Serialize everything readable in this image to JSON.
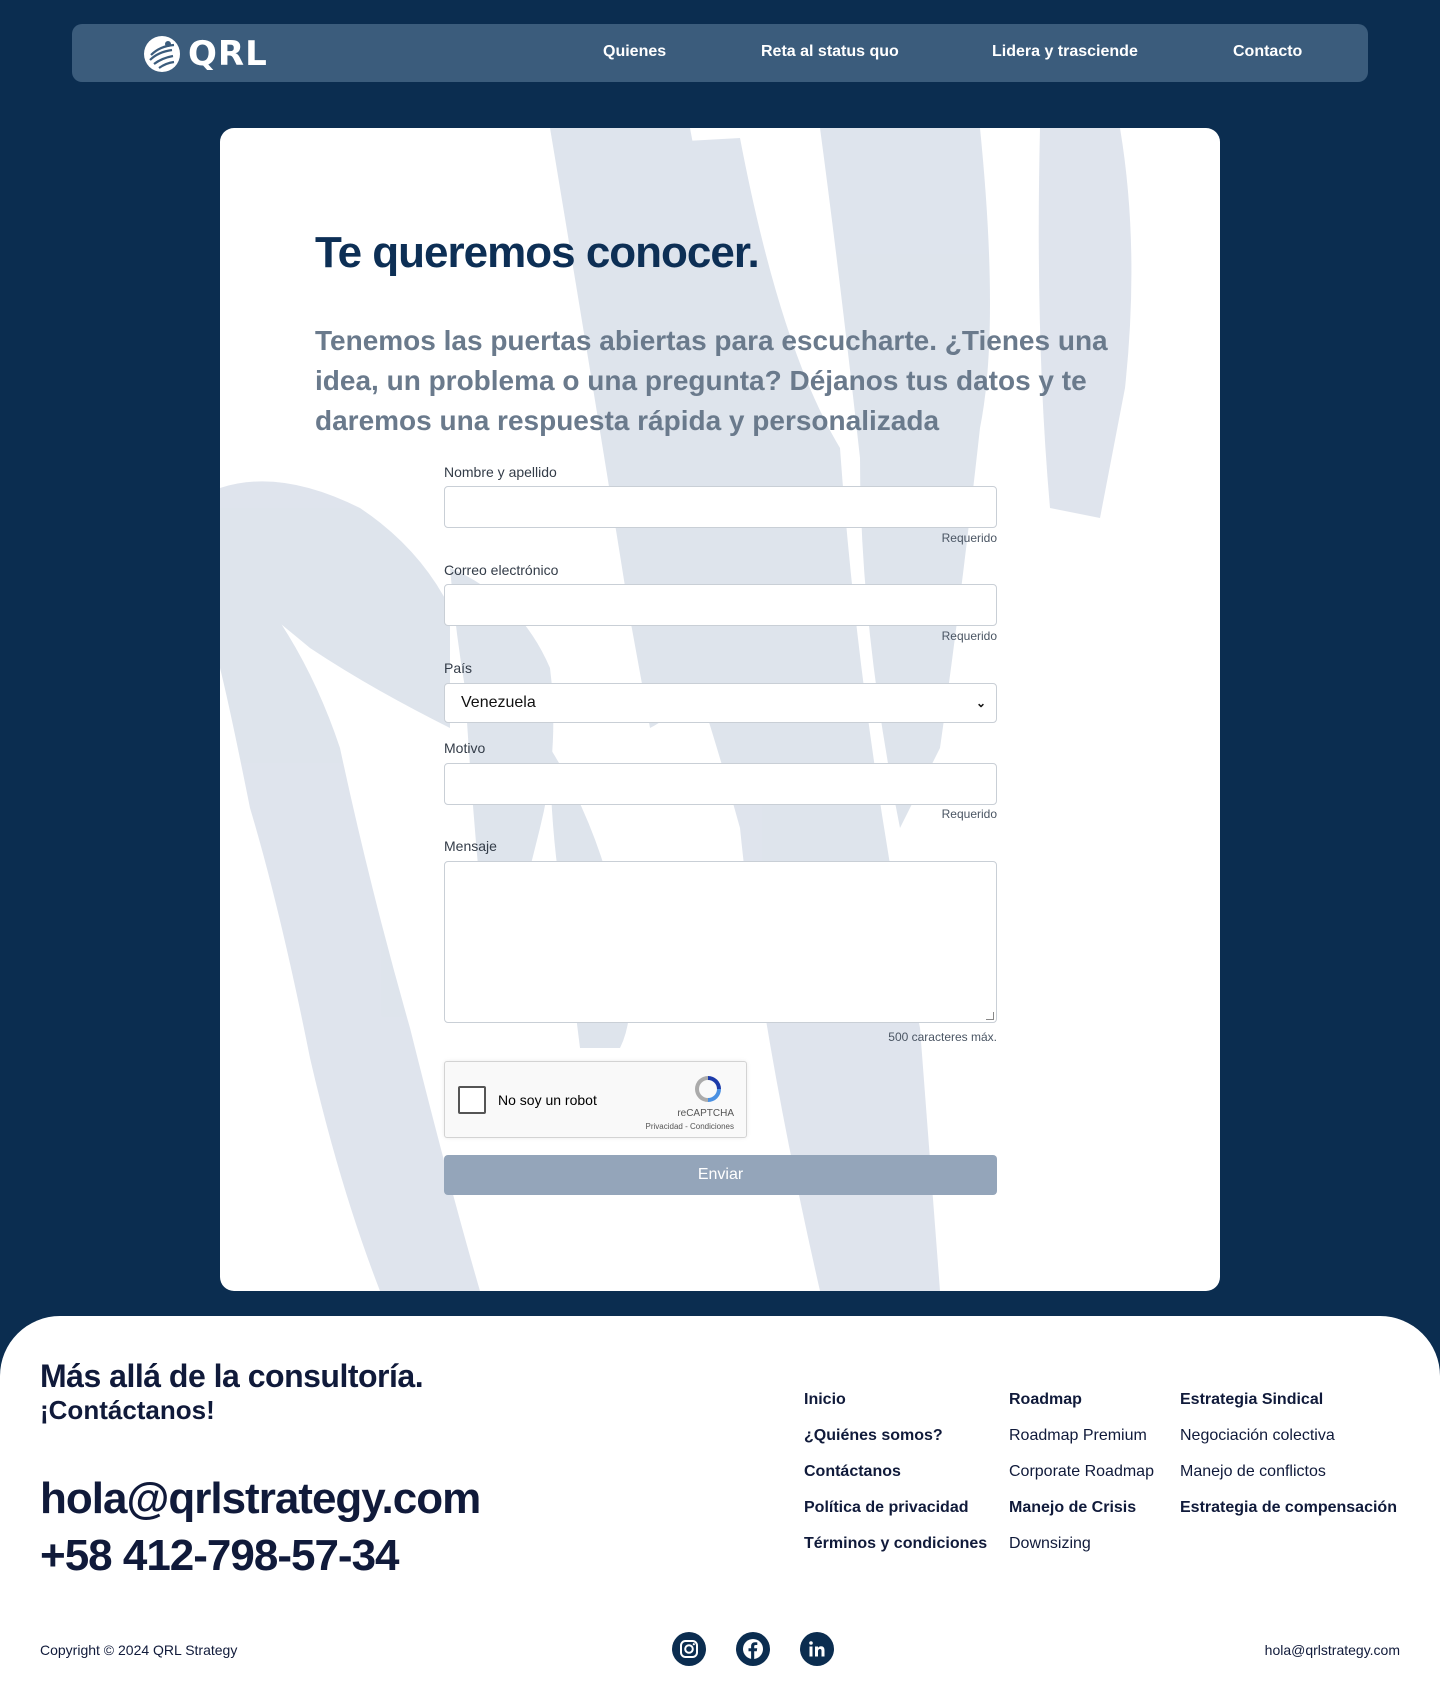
{
  "nav": {
    "logo_text": "QRL",
    "links": [
      "Quienes",
      "Reta al status quo",
      "Lidera y trasciende",
      "Contacto"
    ]
  },
  "form": {
    "title": "Te queremos conocer.",
    "subtitle": "Tenemos las puertas abiertas para escucharte. ¿Tienes una idea, un problema o una pregunta? Déjanos tus datos y te daremos una respuesta rápida y personalizada",
    "name_label": "Nombre y apellido",
    "name_hint": "Requerido",
    "email_label": "Correo electrónico",
    "email_hint": "Requerido",
    "country_label": "País",
    "country_value": "Venezuela",
    "motive_label": "Motivo",
    "motive_hint": "Requerido",
    "message_label": "Mensaje",
    "message_hint": "500 caracteres máx.",
    "captcha_label": "No soy un robot",
    "captcha_brand": "reCAPTCHA",
    "captcha_links": "Privacidad - Condiciones",
    "submit_label": "Enviar"
  },
  "footer": {
    "tagline_1": "Más allá de la consultoría.",
    "tagline_2": "¡Contáctanos!",
    "email": "hola@qrlstrategy.com",
    "phone": "+58 412-798-57-34",
    "col1": [
      "Inicio",
      "¿Quiénes somos?",
      "Contáctanos",
      "Política de privacidad",
      "Términos y condiciones"
    ],
    "col2": [
      "Roadmap",
      "Roadmap Premium",
      "Corporate Roadmap",
      "Manejo de Crisis",
      "Downsizing"
    ],
    "col3": [
      "Estrategia Sindical",
      "Negociación colectiva",
      "Manejo de conflictos",
      "Estrategia de compensación"
    ],
    "copyright": "Copyright © 2024 QRL Strategy",
    "email_small": "hola@qrlstrategy.com",
    "socials": [
      "instagram-icon",
      "facebook-icon",
      "linkedin-icon"
    ]
  },
  "colors": {
    "background": "#0b2d50",
    "nav": "#3b5c7c",
    "title": "#0d2f55",
    "submit": "#94a5ba",
    "brush": "#dde3ec"
  }
}
